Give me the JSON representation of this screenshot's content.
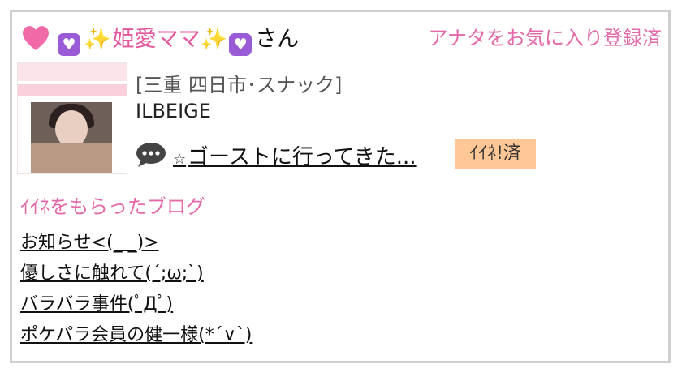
{
  "header": {
    "name_prefix_icons": [
      "heart-icon",
      "purple-heart-icon",
      "sparkles-icon"
    ],
    "name": "姫愛ママ",
    "name_suffix_icons": [
      "sparkles-icon",
      "purple-heart-icon"
    ],
    "honorific": "さん",
    "favorite_status": "アナタをお気に入り登録済"
  },
  "profile": {
    "location": "[三重 四日市･スナック]",
    "shop": "ILBEIGE",
    "post_icon": "speech-bubble-icon",
    "post_prefix": "☆",
    "post_title": "ゴーストに行ってきた...",
    "liked_badge": "ｲｲﾈ!済"
  },
  "section": {
    "title": "ｲｲﾈをもらったブログ",
    "blogs": [
      "お知らせ<(_ _)>",
      "優しさに触れて(´;ω;`)",
      "バラバラ事件(ﾟДﾟ)",
      "ポケパラ会員の健一様(*´∨`)"
    ]
  },
  "colors": {
    "accent_pink": "#e36aa8",
    "badge_orange": "#ffc795",
    "border_gray": "#cfcfcf"
  }
}
